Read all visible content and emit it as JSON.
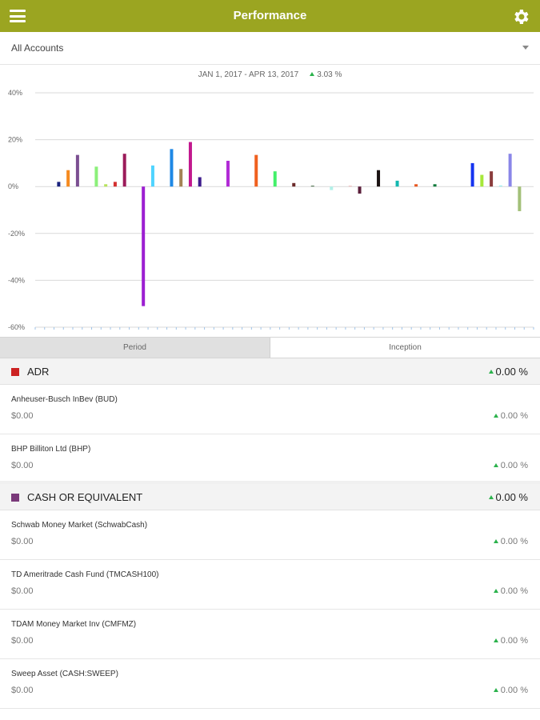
{
  "header": {
    "title": "Performance"
  },
  "account_selector": {
    "value": "All Accounts"
  },
  "range": {
    "label": "JAN 1, 2017 - APR 13, 2017",
    "change": "3.03 %"
  },
  "segments": {
    "period": "Period",
    "inception": "Inception"
  },
  "groups": [
    {
      "name": "ADR",
      "color": "#cc2222",
      "change": "0.00 %",
      "items": [
        {
          "name": "Anheuser-Busch InBev (BUD)",
          "value": "$0.00",
          "change": "0.00 %"
        },
        {
          "name": "BHP Billiton Ltd (BHP)",
          "value": "$0.00",
          "change": "0.00 %"
        }
      ]
    },
    {
      "name": "CASH OR EQUIVALENT",
      "color": "#7a3a7a",
      "change": "0.00 %",
      "items": [
        {
          "name": "Schwab Money Market (SchwabCash)",
          "value": "$0.00",
          "change": "0.00 %"
        },
        {
          "name": "TD Ameritrade Cash Fund (TMCASH100)",
          "value": "$0.00",
          "change": "0.00 %"
        },
        {
          "name": "TDAM Money Market Inv (CMFMZ)",
          "value": "$0.00",
          "change": "0.00 %"
        },
        {
          "name": "Sweep Asset (CASH:SWEEP)",
          "value": "$0.00",
          "change": "0.00 %"
        }
      ]
    }
  ],
  "colors": {
    "accent": "#9ba521",
    "positive": "#2bb24c"
  },
  "chart_data": {
    "type": "bar",
    "ylim": [
      -60,
      40
    ],
    "y_ticks": [
      "40%",
      "20%",
      "0%",
      "-20%",
      "-40%",
      "-60%"
    ],
    "grid": true,
    "bars": [
      {
        "slot": 2,
        "value": 2.0,
        "color": "#1a237e"
      },
      {
        "slot": 3,
        "value": 7.0,
        "color": "#f58a1f"
      },
      {
        "slot": 4,
        "value": 13.5,
        "color": "#7b4f91"
      },
      {
        "slot": 6,
        "value": 8.5,
        "color": "#8cf07a"
      },
      {
        "slot": 7,
        "value": 1.0,
        "color": "#b6e35a"
      },
      {
        "slot": 8,
        "value": 2.0,
        "color": "#d32f2f"
      },
      {
        "slot": 9,
        "value": 14.0,
        "color": "#9b1b5a"
      },
      {
        "slot": 11,
        "value": -51.0,
        "color": "#9c1fd1"
      },
      {
        "slot": 12,
        "value": 9.0,
        "color": "#4fd4ff"
      },
      {
        "slot": 14,
        "value": 16.0,
        "color": "#1e88e5"
      },
      {
        "slot": 15,
        "value": 7.5,
        "color": "#a38354"
      },
      {
        "slot": 16,
        "value": 19.0,
        "color": "#c2188e"
      },
      {
        "slot": 17,
        "value": 4.0,
        "color": "#3d1c8c"
      },
      {
        "slot": 20,
        "value": 11.0,
        "color": "#b12bd6"
      },
      {
        "slot": 23,
        "value": 13.5,
        "color": "#f0601f"
      },
      {
        "slot": 25,
        "value": 6.5,
        "color": "#43f06a"
      },
      {
        "slot": 27,
        "value": 1.5,
        "color": "#6b2a2a"
      },
      {
        "slot": 29,
        "value": 0.4,
        "color": "#5a7a5a"
      },
      {
        "slot": 31,
        "value": -1.5,
        "color": "#b2f0e8"
      },
      {
        "slot": 33,
        "value": 0.4,
        "color": "#f0c0c0"
      },
      {
        "slot": 34,
        "value": -3.0,
        "color": "#5a1e3a"
      },
      {
        "slot": 36,
        "value": 7.0,
        "color": "#1a1212"
      },
      {
        "slot": 38,
        "value": 2.5,
        "color": "#14b8b0"
      },
      {
        "slot": 40,
        "value": 1.0,
        "color": "#e8571f"
      },
      {
        "slot": 42,
        "value": 1.0,
        "color": "#0f7a3a"
      },
      {
        "slot": 46,
        "value": 10.0,
        "color": "#1433f0"
      },
      {
        "slot": 47,
        "value": 5.0,
        "color": "#a6e83a"
      },
      {
        "slot": 48,
        "value": 6.5,
        "color": "#8a3c3c"
      },
      {
        "slot": 49,
        "value": 0.5,
        "color": "#a6f0f0"
      },
      {
        "slot": 50,
        "value": 14.0,
        "color": "#8a86e8"
      },
      {
        "slot": 51,
        "value": -10.5,
        "color": "#a3c079"
      }
    ]
  }
}
